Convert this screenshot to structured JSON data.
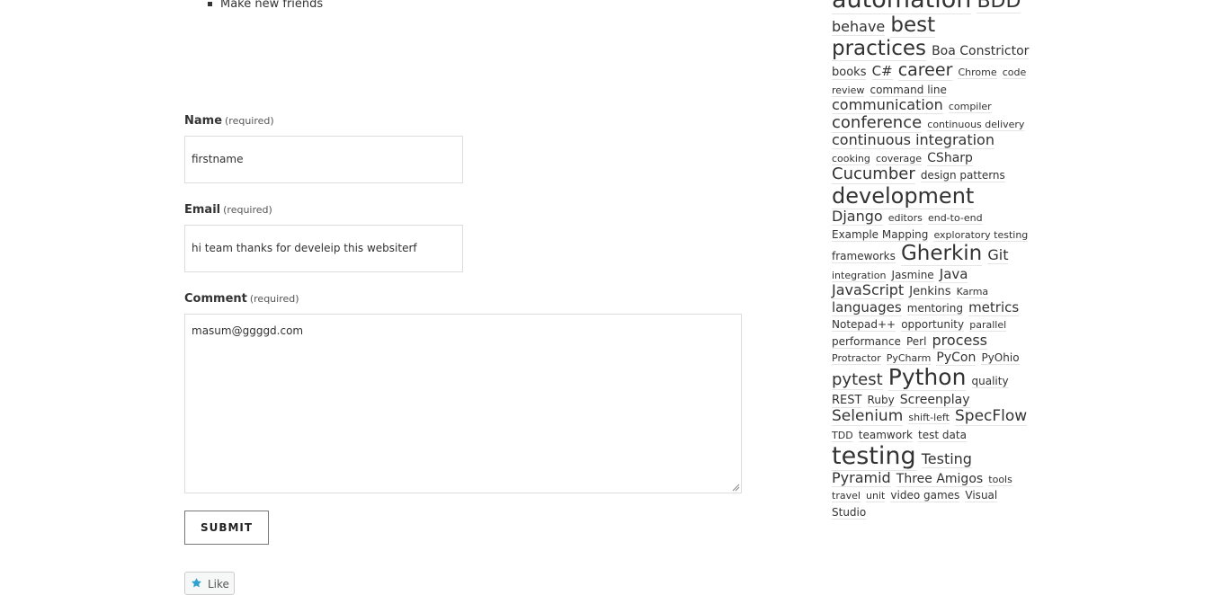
{
  "content": {
    "list_items": [
      "Make new friends"
    ]
  },
  "form": {
    "required_tag": "(required)",
    "name_label": "Name",
    "name_value": "firstname",
    "email_label": "Email",
    "email_value": "hi team thanks for develeip this websiterf",
    "comment_label": "Comment",
    "comment_value": "masum@ggggd.com",
    "submit_label": "SUBMIT"
  },
  "like": {
    "label": "Like",
    "icon": "star-icon",
    "icon_color": "#2ea2cc"
  },
  "tag_cloud": {
    "tags": [
      {
        "label": "automation",
        "size": 27
      },
      {
        "label": "BDD",
        "size": 22
      },
      {
        "label": "behave",
        "size": 16
      },
      {
        "label": "best practices",
        "size": 23
      },
      {
        "label": "Boa Constrictor",
        "size": 14
      },
      {
        "label": "books",
        "size": 13
      },
      {
        "label": "C#",
        "size": 15
      },
      {
        "label": "career",
        "size": 19
      },
      {
        "label": "Chrome",
        "size": 11
      },
      {
        "label": "code review",
        "size": 11
      },
      {
        "label": "command line",
        "size": 12
      },
      {
        "label": "communication",
        "size": 16
      },
      {
        "label": "compiler",
        "size": 11
      },
      {
        "label": "conference",
        "size": 18
      },
      {
        "label": "continuous delivery",
        "size": 11
      },
      {
        "label": "continuous integration",
        "size": 16
      },
      {
        "label": "cooking",
        "size": 11
      },
      {
        "label": "coverage",
        "size": 11
      },
      {
        "label": "CSharp",
        "size": 14
      },
      {
        "label": "Cucumber",
        "size": 18
      },
      {
        "label": "design patterns",
        "size": 12
      },
      {
        "label": "development",
        "size": 24
      },
      {
        "label": "Django",
        "size": 16
      },
      {
        "label": "editors",
        "size": 11
      },
      {
        "label": "end-to-end",
        "size": 11
      },
      {
        "label": "Example Mapping",
        "size": 12
      },
      {
        "label": "exploratory testing",
        "size": 11
      },
      {
        "label": "frameworks",
        "size": 12
      },
      {
        "label": "Gherkin",
        "size": 23
      },
      {
        "label": "Git",
        "size": 16
      },
      {
        "label": "integration",
        "size": 11
      },
      {
        "label": "Jasmine",
        "size": 12
      },
      {
        "label": "Java",
        "size": 15
      },
      {
        "label": "JavaScript",
        "size": 16
      },
      {
        "label": "Jenkins",
        "size": 13
      },
      {
        "label": "Karma",
        "size": 11
      },
      {
        "label": "languages",
        "size": 15
      },
      {
        "label": "mentoring",
        "size": 12
      },
      {
        "label": "metrics",
        "size": 15
      },
      {
        "label": "Notepad++",
        "size": 12
      },
      {
        "label": "opportunity",
        "size": 12
      },
      {
        "label": "parallel",
        "size": 11
      },
      {
        "label": "performance",
        "size": 12
      },
      {
        "label": "Perl",
        "size": 12
      },
      {
        "label": "process",
        "size": 16
      },
      {
        "label": "Protractor",
        "size": 11
      },
      {
        "label": "PyCharm",
        "size": 11
      },
      {
        "label": "PyCon",
        "size": 14
      },
      {
        "label": "PyOhio",
        "size": 12
      },
      {
        "label": "pytest",
        "size": 18
      },
      {
        "label": "Python",
        "size": 25
      },
      {
        "label": "quality",
        "size": 12
      },
      {
        "label": "REST",
        "size": 13
      },
      {
        "label": "Ruby",
        "size": 12
      },
      {
        "label": "Screenplay",
        "size": 14
      },
      {
        "label": "Selenium",
        "size": 17
      },
      {
        "label": "shift-left",
        "size": 11
      },
      {
        "label": "SpecFlow",
        "size": 17
      },
      {
        "label": "TDD",
        "size": 11
      },
      {
        "label": "teamwork",
        "size": 12
      },
      {
        "label": "test data",
        "size": 12
      },
      {
        "label": "testing",
        "size": 27
      },
      {
        "label": "Testing Pyramid",
        "size": 16
      },
      {
        "label": "Three Amigos",
        "size": 14
      },
      {
        "label": "tools",
        "size": 11
      },
      {
        "label": "travel",
        "size": 11
      },
      {
        "label": "unit",
        "size": 11
      },
      {
        "label": "video games",
        "size": 12
      },
      {
        "label": "Visual Studio",
        "size": 12
      }
    ]
  }
}
